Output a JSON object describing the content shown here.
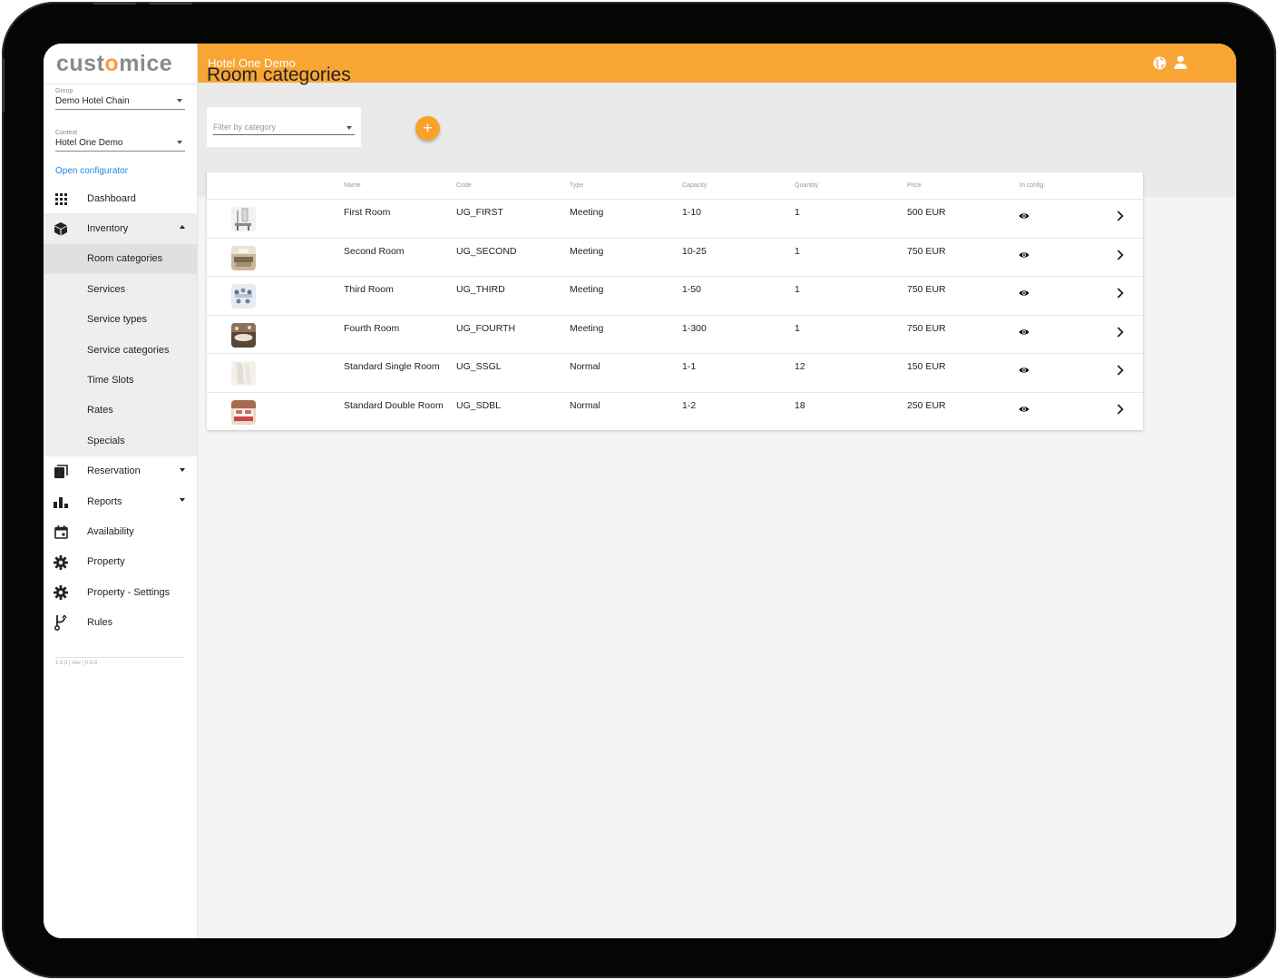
{
  "app": {
    "logo_prefix": "cust",
    "logo_o": "o",
    "logo_suffix": "mice",
    "hotel_title": "Hotel One Demo",
    "version": "1.0.0 | dev | 0.9.8"
  },
  "sidebar": {
    "group_label": "Group",
    "group_value": "Demo Hotel Chain",
    "context_label": "Context",
    "context_value": "Hotel One Demo",
    "open_configurator": "Open configurator",
    "items": [
      {
        "label": "Dashboard",
        "icon": "grid-icon"
      },
      {
        "label": "Inventory",
        "icon": "cube-icon",
        "expanded": true
      },
      {
        "label": "Reservation",
        "icon": "book-icon"
      },
      {
        "label": "Reports",
        "icon": "bar-chart-icon"
      },
      {
        "label": "Availability",
        "icon": "calendar-icon"
      },
      {
        "label": "Property",
        "icon": "gear-icon"
      },
      {
        "label": "Property - Settings",
        "icon": "gear-icon"
      },
      {
        "label": "Rules",
        "icon": "fork-icon"
      }
    ],
    "inventory_sub": [
      {
        "label": "Room categories",
        "active": true
      },
      {
        "label": "Services"
      },
      {
        "label": "Service types"
      },
      {
        "label": "Service categories"
      },
      {
        "label": "Time Slots"
      },
      {
        "label": "Rates"
      },
      {
        "label": "Specials"
      }
    ]
  },
  "main": {
    "title": "Room categories",
    "filter_placeholder": "Filter by category",
    "add_label": "+",
    "columns": [
      "Name",
      "Code",
      "Type",
      "Capacity",
      "Quantity",
      "Price",
      "In config."
    ],
    "rows": [
      {
        "name": "First Room",
        "code": "UG_FIRST",
        "type": "Meeting",
        "capacity": "1-10",
        "quantity": "1",
        "price": "500 EUR"
      },
      {
        "name": "Second Room",
        "code": "UG_SECOND",
        "type": "Meeting",
        "capacity": "10-25",
        "quantity": "1",
        "price": "750 EUR"
      },
      {
        "name": "Third Room",
        "code": "UG_THIRD",
        "type": "Meeting",
        "capacity": "1-50",
        "quantity": "1",
        "price": "750 EUR"
      },
      {
        "name": "Fourth Room",
        "code": "UG_FOURTH",
        "type": "Meeting",
        "capacity": "1-300",
        "quantity": "1",
        "price": "750 EUR"
      },
      {
        "name": "Standard Single Room",
        "code": "UG_SSGL",
        "type": "Normal",
        "capacity": "1-1",
        "quantity": "12",
        "price": "150 EUR"
      },
      {
        "name": "Standard Double Room",
        "code": "UG_SDBL",
        "type": "Normal",
        "capacity": "1-2",
        "quantity": "18",
        "price": "250 EUR"
      }
    ]
  },
  "colors": {
    "accent": "#f8a533",
    "link": "#1e88e5"
  }
}
